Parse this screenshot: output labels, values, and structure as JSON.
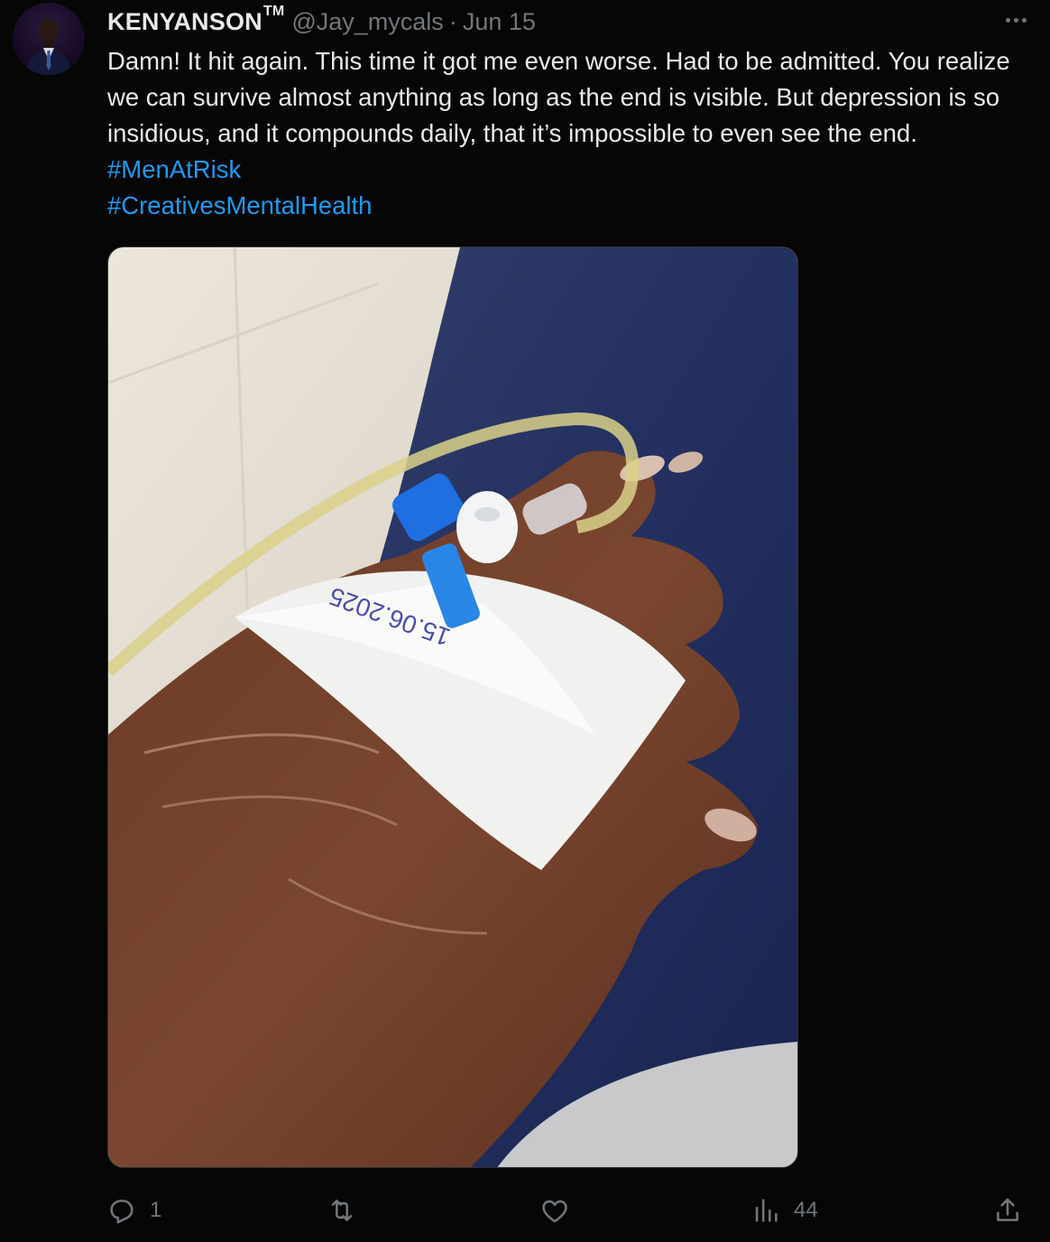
{
  "tweet": {
    "display_name": "KENYANSON",
    "display_name_suffix": "TM",
    "handle": "@Jay_mycals",
    "separator": "·",
    "date": "Jun 15",
    "text_plain": "Damn! It hit again. This time it got me even worse. Had to be admitted. You realize we can survive almost anything as long as the end is visible. But depression is so insidious, and it compounds daily, that it’s impossible to even see the end.",
    "hashtags": [
      "#MenAtRisk",
      "#CreativesMentalHealth"
    ],
    "media": {
      "bandage_writing": "15.06.2025"
    }
  },
  "actions": {
    "reply_count": "1",
    "retweet_count": "",
    "like_count": "",
    "views_count": "44"
  },
  "icons": {
    "more": "more-icon",
    "reply": "reply-icon",
    "retweet": "retweet-icon",
    "like": "like-icon",
    "views": "views-icon",
    "share": "share-icon"
  },
  "colors": {
    "background": "#060606",
    "text": "#e7e9ea",
    "muted": "#71767b",
    "link": "#1d9bf0"
  }
}
